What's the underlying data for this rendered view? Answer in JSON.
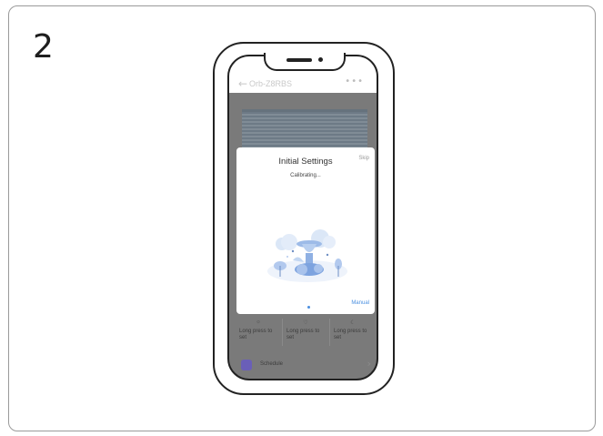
{
  "step": {
    "number": "2"
  },
  "app": {
    "header": {
      "device_name": "Orb-Z8RBS",
      "back_icon": "arrow-left-icon",
      "more_icon": "more-dots-icon"
    },
    "dialog": {
      "title": "Initial Settings",
      "skip_label": "Skip",
      "status": "Calibrating...",
      "manual_label": "Manual"
    },
    "presets": [
      {
        "icon": "sun-icon",
        "label": "Long press to set"
      },
      {
        "icon": "heart-icon",
        "label": "Long press to set"
      },
      {
        "icon": "moon-icon",
        "label": "Long press to set"
      }
    ],
    "schedule": {
      "label": "Schedule",
      "icon": "calendar-icon"
    }
  },
  "colors": {
    "accent": "#4a8fe0",
    "overlay": "#7a7a7a",
    "schedule_icon": "#6a5fb8"
  }
}
